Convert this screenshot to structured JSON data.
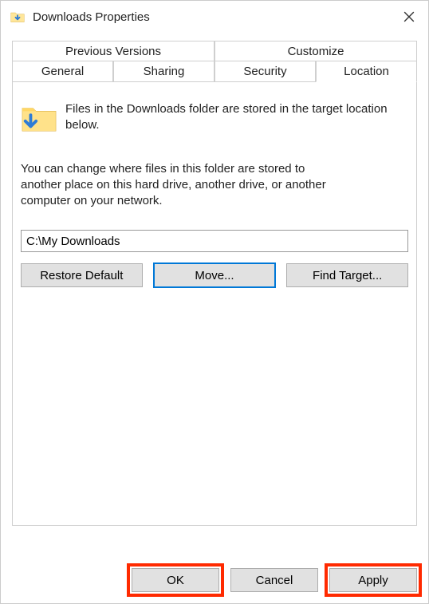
{
  "window": {
    "title": "Downloads Properties"
  },
  "tabs": {
    "row1": [
      "Previous Versions",
      "Customize"
    ],
    "row2": [
      "General",
      "Sharing",
      "Security",
      "Location"
    ],
    "active": "Location"
  },
  "location": {
    "intro": "Files in the Downloads folder are stored in the target location below.",
    "para": "You can change where files in this folder are stored to another place on this hard drive, another drive, or another computer on your network.",
    "path": "C:\\My Downloads",
    "buttons": {
      "restore": "Restore Default",
      "move": "Move...",
      "find": "Find Target..."
    }
  },
  "dialog": {
    "ok": "OK",
    "cancel": "Cancel",
    "apply": "Apply"
  }
}
